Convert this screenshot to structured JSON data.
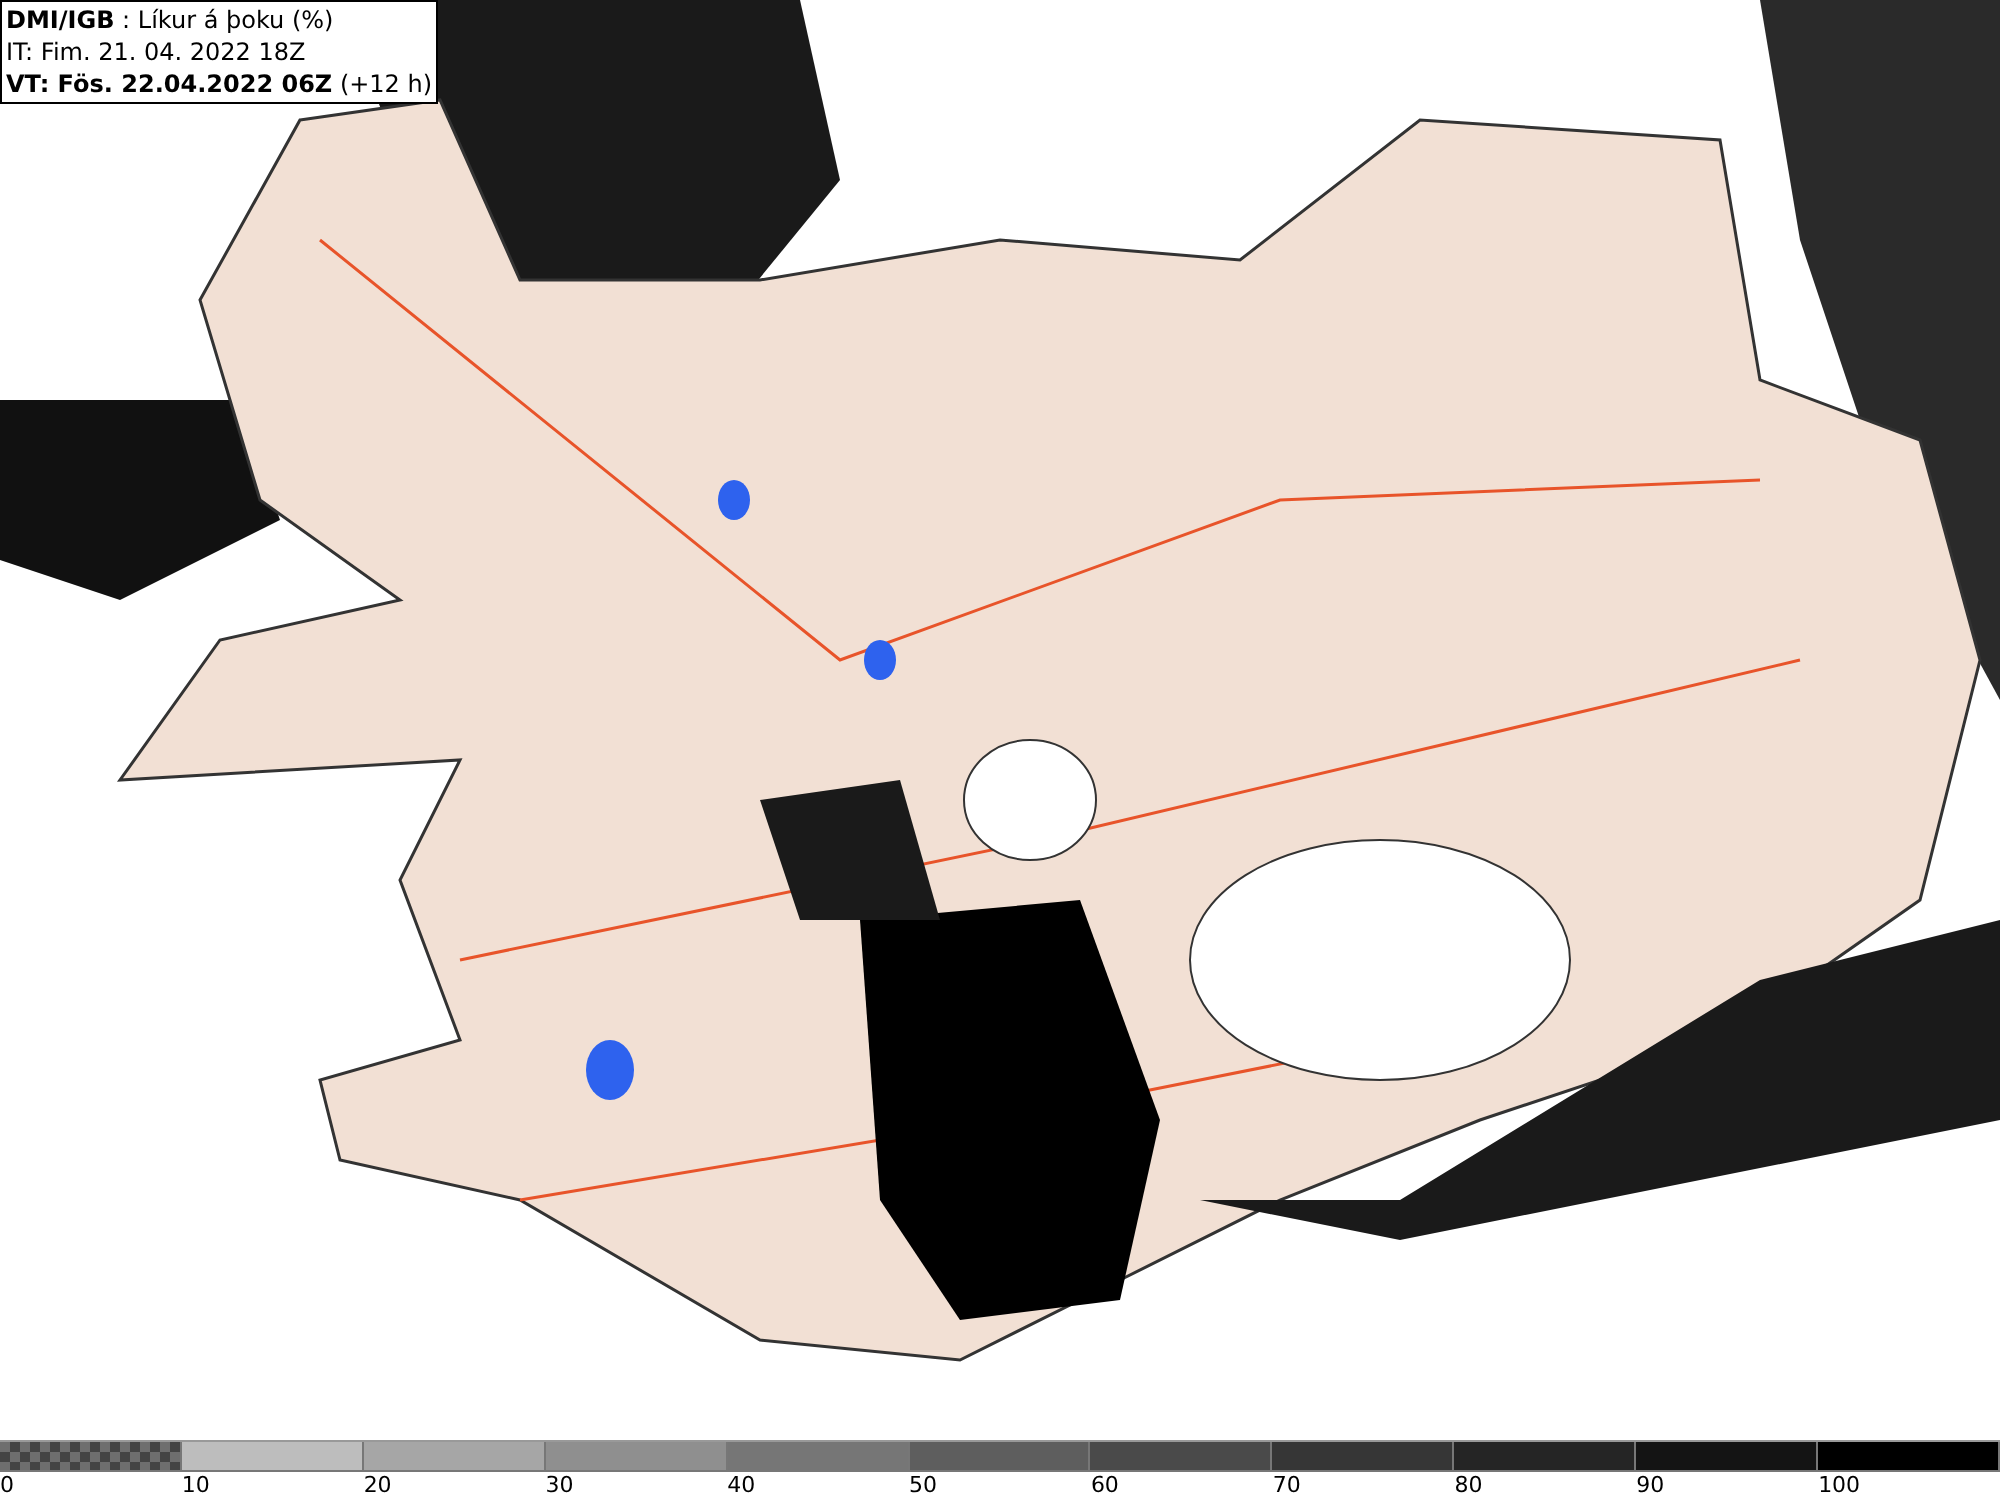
{
  "header": {
    "lines": [
      "**DMI/IGB** : Líkur á þoku (%)",
      "IT: Fim. 21. 04. 2022 18Z",
      "**VT: Fös. 22.04.2022 06Z** (+12 h)"
    ]
  },
  "legend": {
    "segments": [
      {
        "label": "0",
        "kind": "checker",
        "color": "#6e6e6e"
      },
      {
        "label": "10",
        "kind": "solid",
        "color": "#bdbdbd"
      },
      {
        "label": "20",
        "kind": "solid",
        "color": "#a6a6a6"
      },
      {
        "label": "30",
        "kind": "solid",
        "color": "#8f8f8f"
      },
      {
        "label": "40",
        "kind": "solid",
        "color": "#767676"
      },
      {
        "label": "50",
        "kind": "solid",
        "color": "#5e5e5e"
      },
      {
        "label": "60",
        "kind": "solid",
        "color": "#4a4a4a"
      },
      {
        "label": "70",
        "kind": "solid",
        "color": "#363636"
      },
      {
        "label": "80",
        "kind": "solid",
        "color": "#252525"
      },
      {
        "label": "90",
        "kind": "solid",
        "color": "#141414"
      },
      {
        "label": "100",
        "kind": "solid",
        "color": "#000000"
      }
    ]
  }
}
